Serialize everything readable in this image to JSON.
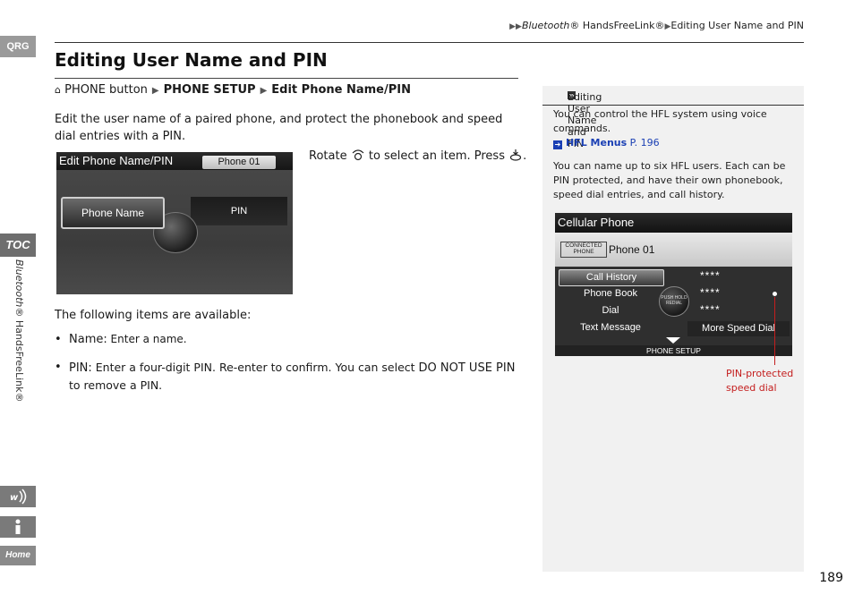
{
  "tabs": {
    "qrg": "QRG",
    "toc": "TOC",
    "side_label_italic": "Bluetooth®",
    "side_label_rest": " HandsFreeLink®",
    "home": "Home"
  },
  "breadcrumb": {
    "part1": "Bluetooth",
    "part2": "® HandsFreeLink®",
    "part3": "Editing User Name and PIN"
  },
  "title": "Editing User Name and PIN",
  "nav_path": {
    "start": "PHONE button",
    "step1": "PHONE SETUP",
    "step2": "Edit Phone Name/PIN"
  },
  "intro": "Edit the user name of a paired phone, and protect the phonebook and speed dial entries with a PIN.",
  "screen1": {
    "title": "Edit Phone Name/PIN",
    "phone": "Phone 01",
    "selected": "Phone Name",
    "pin": "PIN"
  },
  "rotate_text": {
    "a": "Rotate",
    "b": "to select an item. Press",
    "c": "."
  },
  "items_intro": "The following items are available:",
  "bullets": [
    {
      "term": "Name:",
      "desc": " Enter a name."
    },
    {
      "term": "PIN:",
      "desc": " Enter a four-digit PIN. Re-enter to confirm. You can select ",
      "emph": "DO NOT USE PIN",
      "tail": " to remove a PIN."
    }
  ],
  "sidebar": {
    "heading": "Editing User Name and PIN",
    "p1": "You can control the HFL system using voice commands.",
    "link_text": "HFL Menus",
    "link_page": " P. 196",
    "p2": "You can name up to six HFL users. Each can be PIN protected, and have their own phonebook, speed dial entries, and call history."
  },
  "screen2": {
    "title": "Cellular Phone",
    "connected": "CONNECTED PHONE",
    "phone": "Phone 01",
    "items": [
      "Call History",
      "Phone Book",
      "Dial",
      "Text Message"
    ],
    "pins": [
      "****",
      "****",
      "****"
    ],
    "more": "More Speed Dial",
    "knob": "PUSH HOLD REDIAL",
    "footer": "PHONE SETUP"
  },
  "callout": {
    "line1": "PIN-protected",
    "line2": "speed dial"
  },
  "page_number": "189"
}
